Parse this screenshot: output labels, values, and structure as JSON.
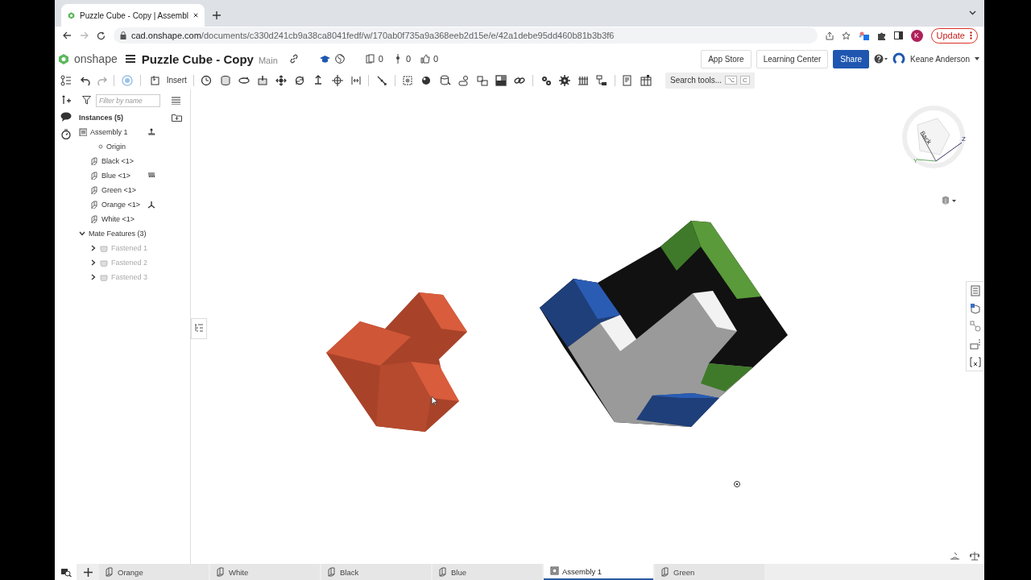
{
  "browser": {
    "tab_title": "Puzzle Cube - Copy | Assembl",
    "url_host": "cad.onshape.com",
    "url_path": "/documents/c330d241cb9a38ca8041fedf/w/170ab0f735a9a368eeb2d15e/e/42a1debe95dd460b81b3b3f6",
    "profile_initial": "K",
    "update_button": "Update"
  },
  "header": {
    "logo": "onshape",
    "document_title": "Puzzle Cube - Copy",
    "branch": "Main",
    "counts": [
      "0",
      "0",
      "0"
    ],
    "buttons": [
      {
        "label": "App Store",
        "kind": "plain"
      },
      {
        "label": "Learning Center",
        "kind": "plain"
      },
      {
        "label": "Share",
        "kind": "primary"
      }
    ],
    "user": "Keane Anderson"
  },
  "toolbar": {
    "insert": "Insert",
    "search": "Search tools...",
    "shortcut": [
      "⌥",
      "C"
    ]
  },
  "panel": {
    "filter_placeholder": "Filter by name",
    "heading": "Instances (5)",
    "tree": [
      {
        "label": "Assembly 1",
        "kind": "assembly",
        "grounded": true,
        "expanded": true,
        "children": [
          {
            "label": "Origin",
            "kind": "origin",
            "fixed": false,
            "has_connector": false
          },
          {
            "label": "Black <1>",
            "kind": "part",
            "fixed": false,
            "has_connector": false
          },
          {
            "label": "Blue <1>",
            "kind": "part",
            "fixed": true,
            "has_connector": false
          },
          {
            "label": "Green <1>",
            "kind": "part",
            "fixed": false,
            "has_connector": false
          },
          {
            "label": "Orange <1>",
            "kind": "part",
            "fixed": false,
            "has_connector": true
          },
          {
            "label": "White <1>",
            "kind": "part",
            "fixed": false,
            "has_connector": false
          }
        ]
      },
      {
        "label": "Mate Features (3)",
        "kind": "folder",
        "expanded": true,
        "children": [
          {
            "label": "Fastened 1",
            "kind": "mate",
            "expanded": false,
            "dimmed": true
          },
          {
            "label": "Fastened 2",
            "kind": "mate",
            "expanded": false,
            "dimmed": true
          },
          {
            "label": "Fastened 3",
            "kind": "mate",
            "expanded": false,
            "dimmed": true
          }
        ]
      }
    ]
  },
  "view_cube": {
    "face": "Back",
    "axes": [
      "Z",
      "Y"
    ]
  },
  "bottom_tabs": [
    {
      "label": "Orange",
      "kind": "part_studio",
      "selected": false
    },
    {
      "label": "White",
      "kind": "part_studio",
      "selected": false
    },
    {
      "label": "Black",
      "kind": "part_studio",
      "selected": false
    },
    {
      "label": "Blue",
      "kind": "part_studio",
      "selected": false
    },
    {
      "label": "Assembly 1",
      "kind": "assembly",
      "selected": true
    },
    {
      "label": "Green",
      "kind": "part_studio",
      "selected": false
    }
  ]
}
